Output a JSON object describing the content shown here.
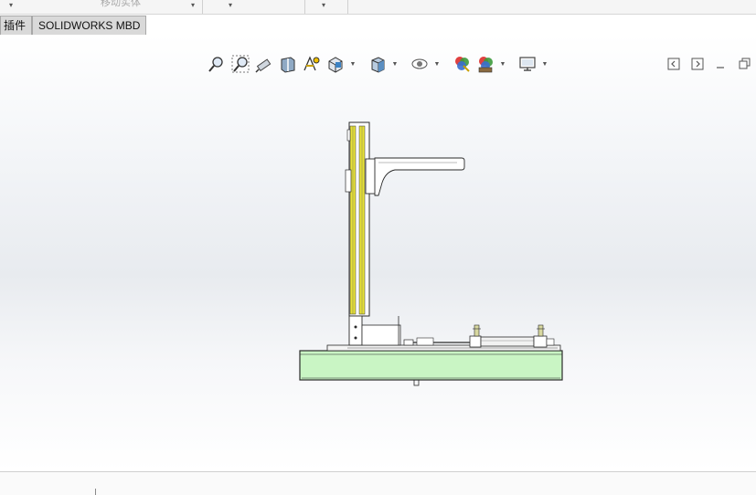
{
  "ribbon": {
    "faded_label": "移动实体"
  },
  "tabs": [
    {
      "label": "插件"
    },
    {
      "label": "SOLIDWORKS MBD"
    }
  ],
  "hud_icons": [
    "zoom-to-fit-icon",
    "zoom-to-area-icon",
    "previous-view-icon",
    "section-view-icon",
    "dynamic-annotation-icon",
    "view-orientation-icon",
    "display-style-icon",
    "hide-show-items-icon",
    "edit-appearance-icon",
    "apply-scene-icon",
    "view-settings-icon"
  ],
  "colors": {
    "accent_yellow": "#e8e23a",
    "base_green": "#c9f5c4",
    "outline": "#2a2a2a"
  }
}
